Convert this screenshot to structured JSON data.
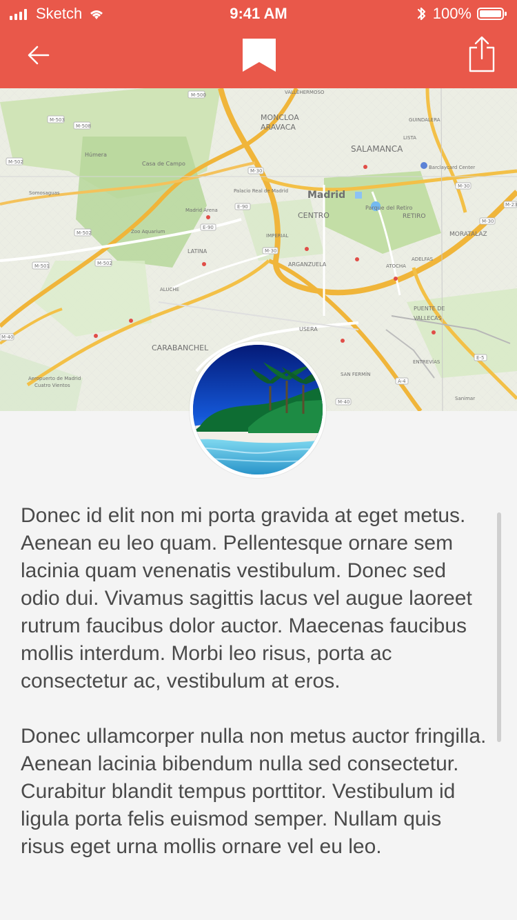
{
  "status": {
    "carrier": "Sketch",
    "time": "9:41 AM",
    "battery": "100%"
  },
  "icons": {
    "back": "arrow-left-icon",
    "bookmark": "bookmark-icon",
    "share": "share-icon",
    "bluetooth": "bluetooth-icon",
    "wifi": "wifi-icon",
    "signal": "signal-icon",
    "battery": "battery-icon"
  },
  "map": {
    "labels": {
      "moncloa": "MONCLOA",
      "aravaca": "ARAVACA",
      "salamanca": "SALAMANCA",
      "humera": "Húmera",
      "casa_de_campo": "Casa de Campo",
      "madrid": "Madrid",
      "centro": "CENTRO",
      "retiro": "RETIRO",
      "moratalaz": "MORATALAZ",
      "parque_del_retiro": "Parque del Retiro",
      "palacio_real": "Palacio Real de Madrid",
      "madrid_arena": "Madrid Arena",
      "zoo": "Zoo Aquarium",
      "somosaguas": "Somosaguas",
      "latina": "LATINA",
      "arganzuela": "ARGANZUELA",
      "usera": "USERA",
      "carabanchel": "CARABANCHEL",
      "aeropuerto": "Aeropuerto de Madrid",
      "cuatro_vientos": "Cuatro Vientos",
      "puente_de_vallecas_1": "PUENTE DE",
      "puente_de_vallecas_2": "VALLECAS",
      "barclaycard": "Barclaycard Center",
      "sanimar": "Sanimar",
      "entrevias": "ENTREVÍAS",
      "san_fermin": "SAN FERMÍN",
      "imperial": "IMPERIAL",
      "atocha": "ATOCHA",
      "adelfas": "ADELFAS",
      "aluche": "ALUCHE",
      "vallehermoso": "VALLEHERMOSO",
      "guindalera": "GUINDALERA",
      "lista": "LISTA"
    },
    "roads": {
      "m30a": "M-30",
      "m30b": "M-30",
      "m30c": "M-30",
      "m30d": "M-30",
      "m40": "M-40",
      "m40b": "M-40",
      "m502": "M-502",
      "m501": "M-501",
      "m500": "M-500",
      "m508": "M-508",
      "m503": "M-503",
      "e90a": "E-90",
      "e90b": "E-90",
      "a4": "A-4",
      "e5": "E-5",
      "m23": "M-23"
    }
  },
  "content": {
    "paragraph1": "Donec id elit non mi porta gravida at eget metus. Aenean eu leo quam. Pellentesque ornare sem lacinia quam venenatis vestibulum. Donec sed odio dui. Vivamus sagittis lacus vel augue laoreet rutrum faucibus dolor auctor. Maecenas faucibus mollis interdum. Morbi leo risus, porta ac consectetur ac, vestibulum at eros.",
    "paragraph2": "Donec ullamcorper nulla non metus auctor fringilla. Aenean lacinia bibendum nulla sed consectetur. Curabitur blandit tempus porttitor. Vestibulum id ligula porta felis euismod semper. Nullam quis risus eget urna mollis ornare vel eu leo."
  },
  "colors": {
    "header": "#e9584a",
    "text": "#4a4a4a",
    "background": "#f4f4f4"
  }
}
